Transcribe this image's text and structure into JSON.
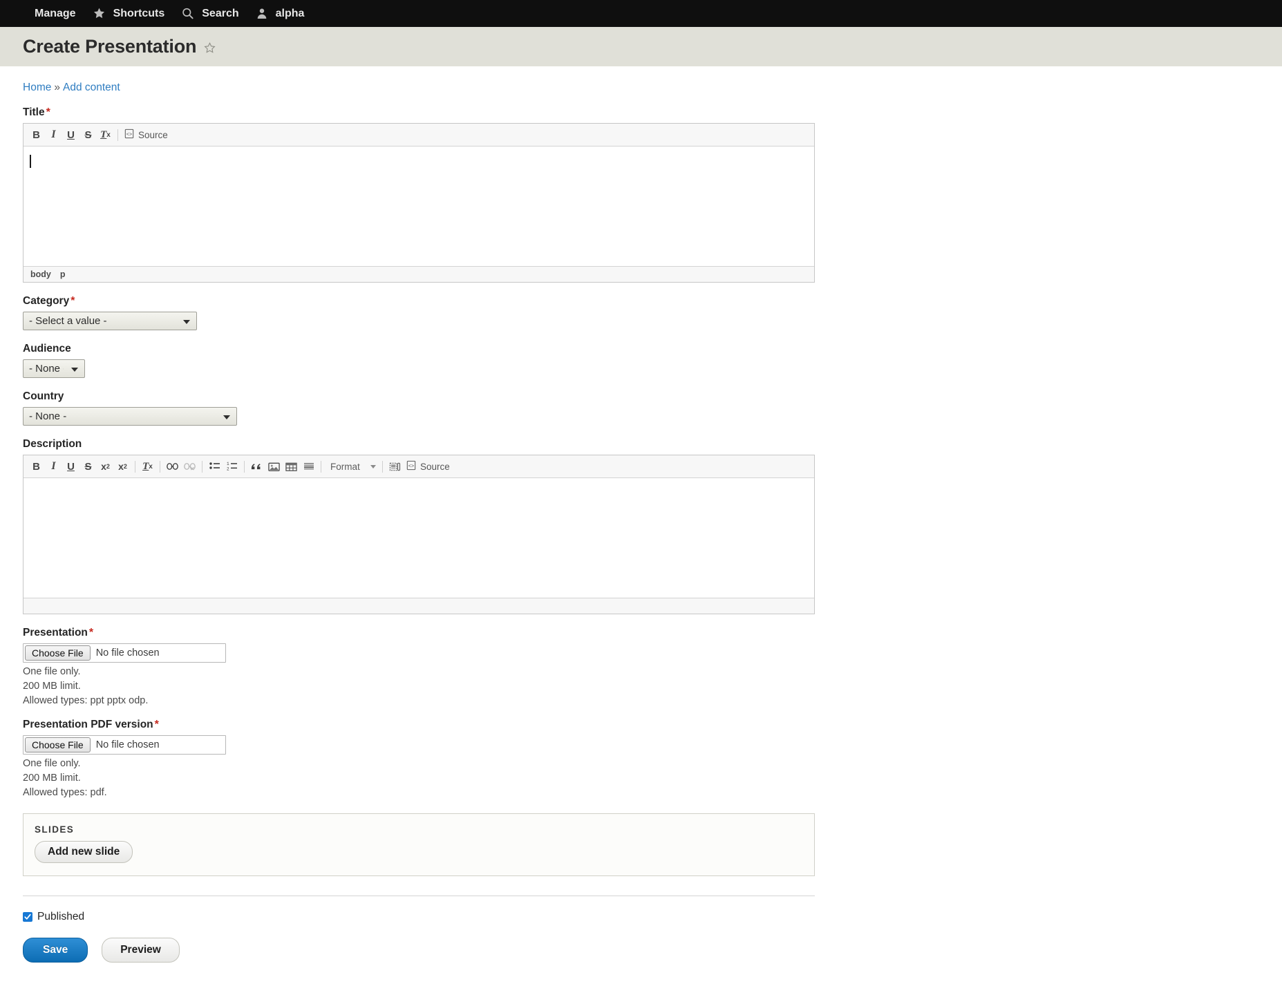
{
  "toolbar": {
    "items": [
      {
        "icon": "hamburger-icon",
        "label": "Manage"
      },
      {
        "icon": "star-icon",
        "label": "Shortcuts"
      },
      {
        "icon": "search-icon",
        "label": "Search"
      },
      {
        "icon": "user-icon",
        "label": "alpha"
      }
    ]
  },
  "page": {
    "title": "Create Presentation",
    "star_icon": "star-outline-icon"
  },
  "breadcrumb": {
    "home": "Home",
    "separator": "»",
    "current": "Add content"
  },
  "form": {
    "title_field": {
      "label": "Title",
      "required_marker": "*",
      "value": "",
      "editor": {
        "buttons": [
          {
            "name": "bold-icon",
            "label": "B"
          },
          {
            "name": "italic-icon",
            "label": "I"
          },
          {
            "name": "underline-icon",
            "label": "U"
          },
          {
            "name": "strikethrough-icon",
            "label": "S"
          },
          {
            "name": "remove-format-icon",
            "label": "Tx"
          }
        ],
        "source_label": "Source",
        "element_path": [
          "body",
          "p"
        ]
      }
    },
    "category_field": {
      "label": "Category",
      "required_marker": "*",
      "selected": "- Select a value -",
      "options": [
        "- Select a value -"
      ]
    },
    "audience_field": {
      "label": "Audience",
      "selected": "- None -",
      "options": [
        "- None -"
      ]
    },
    "country_field": {
      "label": "Country",
      "selected": "- None -",
      "options": [
        "- None -"
      ]
    },
    "description_field": {
      "label": "Description",
      "value": "",
      "editor": {
        "buttons": [
          {
            "name": "bold-icon",
            "label": "B"
          },
          {
            "name": "italic-icon",
            "label": "I"
          },
          {
            "name": "underline-icon",
            "label": "U"
          },
          {
            "name": "strikethrough-icon",
            "label": "S"
          },
          {
            "name": "superscript-icon",
            "label": "x2"
          },
          {
            "name": "subscript-icon",
            "label": "x2"
          },
          {
            "name": "remove-format-icon",
            "label": "Tx"
          },
          {
            "name": "link-icon",
            "label": "Link"
          },
          {
            "name": "unlink-icon",
            "label": "Unlink",
            "disabled": true
          },
          {
            "name": "bulleted-list-icon",
            "label": "Bulleted list"
          },
          {
            "name": "numbered-list-icon",
            "label": "Numbered list"
          },
          {
            "name": "blockquote-icon",
            "label": "Block quote"
          },
          {
            "name": "image-icon",
            "label": "Image"
          },
          {
            "name": "table-icon",
            "label": "Table"
          },
          {
            "name": "horizontal-rule-icon",
            "label": "Horizontal line"
          },
          {
            "name": "template-icon",
            "label": "Templates"
          }
        ],
        "format_label": "Format",
        "source_label": "Source"
      }
    },
    "presentation_field": {
      "label": "Presentation",
      "required_marker": "*",
      "choose_label": "Choose File",
      "file_status": "No file chosen",
      "hints": [
        "One file only.",
        "200 MB limit.",
        "Allowed types: ppt pptx odp."
      ]
    },
    "presentation_pdf_field": {
      "label": "Presentation PDF version",
      "required_marker": "*",
      "choose_label": "Choose File",
      "file_status": "No file chosen",
      "hints": [
        "One file only.",
        "200 MB limit.",
        "Allowed types: pdf."
      ]
    },
    "slides_fieldset": {
      "legend": "SLIDES",
      "add_button": "Add new slide"
    },
    "published": {
      "label": "Published",
      "checked": true
    },
    "actions": {
      "save": "Save",
      "preview": "Preview"
    }
  },
  "colors": {
    "toolbar_bg": "#0f0f0f",
    "page_head_bg": "#e0e0d8",
    "link": "#2f7dc1",
    "required": "#c6291f",
    "primary_button": "#0d6db4",
    "checkbox": "#1778d4"
  }
}
